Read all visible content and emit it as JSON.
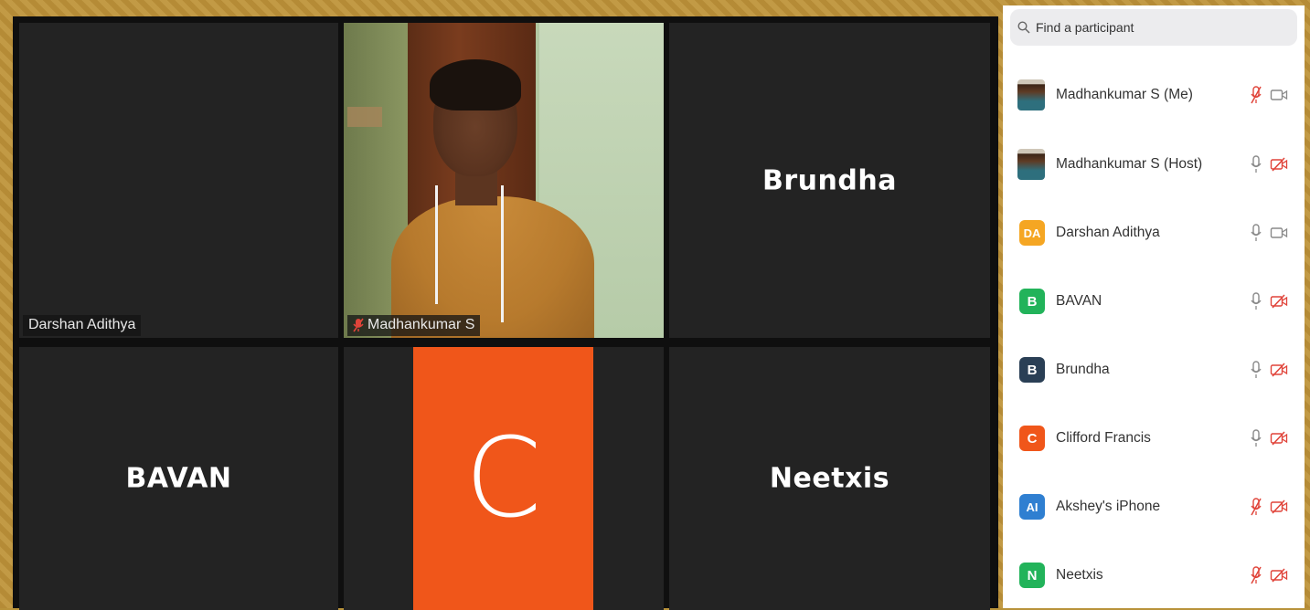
{
  "tiles": [
    {
      "id": "darshan",
      "label": "Darshan Adithya",
      "centered": ""
    },
    {
      "id": "madhankumar",
      "label": "Madhankumar S",
      "muted": true
    },
    {
      "id": "brundha",
      "centered": "Brundha"
    },
    {
      "id": "bavan",
      "centered": "BAVAN"
    },
    {
      "id": "clifford",
      "avatar_letter": "C",
      "avatar_color": "#f0561a"
    },
    {
      "id": "neetxis",
      "centered": "Neetxis"
    }
  ],
  "participants_panel": {
    "search_placeholder": "Find a participant",
    "participants": [
      {
        "name": "Madhankumar S (Me)",
        "avatar_type": "photo",
        "mic": "muted",
        "camera": "on"
      },
      {
        "name": "Madhankumar S (Host)",
        "avatar_type": "photo",
        "mic": "on",
        "camera": "off"
      },
      {
        "name": "Darshan Adithya",
        "initials": "DA",
        "avatar_color": "#f5a623",
        "mic": "on",
        "camera": "on"
      },
      {
        "name": "BAVAN",
        "initials": "B",
        "avatar_color": "#22b35a",
        "mic": "on",
        "camera": "off"
      },
      {
        "name": "Brundha",
        "initials": "B",
        "avatar_color": "#2a3f55",
        "mic": "on",
        "camera": "off"
      },
      {
        "name": "Clifford Francis",
        "initials": "C",
        "avatar_color": "#f0561a",
        "mic": "on",
        "camera": "off"
      },
      {
        "name": "Akshey's iPhone",
        "initials": "AI",
        "avatar_color": "#2f7fd1",
        "mic": "muted",
        "camera": "off"
      },
      {
        "name": "Neetxis",
        "initials": "N",
        "avatar_color": "#22b35a",
        "mic": "muted",
        "camera": "off"
      }
    ]
  },
  "colors": {
    "mute_red": "#e0443a",
    "icon_gray": "#8a8a8a"
  }
}
